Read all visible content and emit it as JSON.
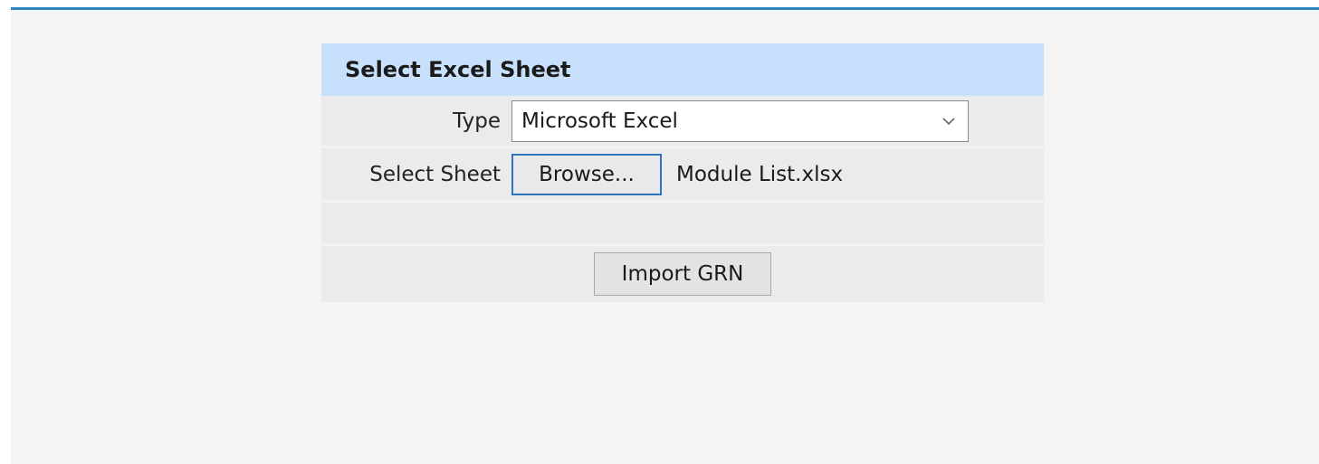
{
  "panel": {
    "title": "Select Excel Sheet"
  },
  "form": {
    "type": {
      "label": "Type",
      "selected": "Microsoft Excel",
      "icon": "chevron-down-icon"
    },
    "sheet": {
      "label": "Select Sheet",
      "browse_label": "Browse...",
      "file_name": "Module List.xlsx"
    },
    "import_label": "Import GRN"
  },
  "colors": {
    "accent": "#2e86c1",
    "header_bg": "#c7e0fb",
    "row_bg": "#ebebeb",
    "page_bg": "#f4f4f4"
  }
}
